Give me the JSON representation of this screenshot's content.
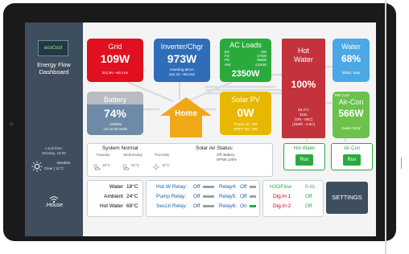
{
  "sidebar": {
    "logo": "ecoCool",
    "title_line1": "Energy Flow",
    "title_line2": "Dashboard",
    "local_time_label": "Local time:",
    "local_time_value": "Monday, 19:08",
    "weather_label": "Weather",
    "weather_value": "Clear | 11°C",
    "nav_label": ".House"
  },
  "tiles": {
    "grid": {
      "name": "Grid",
      "value": "109W",
      "detail": "241.8V ~50.1Hz",
      "color": "#e01020"
    },
    "inverter": {
      "name": "Inverter/Chgr",
      "value": "973W",
      "detail1": "Inverting 5KVA",
      "detail2": "241.3V ~50.0Hz",
      "color": "#2e6db8"
    },
    "ac_loads": {
      "name": "AC Loads",
      "value": "2350W",
      "color": "#2aaa3c",
      "rows": [
        [
          "ES",
          "0W"
        ],
        [
          "FS",
          "175W"
        ],
        [
          "PS",
          "658W"
        ],
        [
          "HW",
          "1315W"
        ]
      ]
    },
    "hot_water": {
      "name1": "Hot",
      "name2": "Water",
      "value": "100%",
      "detail1": "63.4°C",
      "detail2": "315L",
      "detail3": "[ON - 84C]",
      "detail4": "[1kWh - 4.6C]",
      "color": "#c4323c"
    },
    "water": {
      "name": "Water",
      "value": "68%",
      "detail": "3000L Tank",
      "color": "#4aa8e6"
    },
    "battery": {
      "name": "Battery",
      "value": "74%",
      "detail1": "-1005W",
      "detail2": "-15.3A  52.5Vdc",
      "color_top": "#b8bcc0",
      "color_bottom": "#6e8aa6"
    },
    "home": {
      "name": "Home",
      "color": "#f0a818"
    },
    "solar": {
      "name": "Solar PV",
      "value": "0W",
      "detail1": "Phase AC: 0W",
      "detail2": "MPPT DC: 0W",
      "color": "#e8b800"
    },
    "aircon": {
      "name": "Air-Con",
      "value": "566W",
      "detail": "Daikin 5KW",
      "tag": "MR Cool",
      "color": "#6cc24a"
    }
  },
  "system": {
    "status_label": "System Normal",
    "solar_air_label": "Solar Air Status:",
    "solar_air_detail1": "Off, Battery",
    "solar_air_detail2": "DPM6 100%",
    "days": [
      "Tuesday",
      "Wednesday",
      "Thursday"
    ],
    "temps": [
      "18°C",
      "21°C",
      "11°C"
    ]
  },
  "buttons": {
    "hot_water_label": "Hot Water",
    "hot_water_run": "Run",
    "aircon_label": "Air-Con",
    "aircon_run": "Run",
    "settings": "SETTINGS"
  },
  "temps_box": {
    "rows": [
      [
        "Water",
        "18°C"
      ],
      [
        "Ambient",
        "24°C"
      ],
      [
        "Hot Water",
        "68°C"
      ]
    ]
  },
  "relays": {
    "col1": [
      [
        "Hot W Relay:",
        "Off"
      ],
      [
        "Pump Relay:",
        "Off"
      ],
      [
        "SecLit Relay:",
        "Off"
      ]
    ],
    "col2": [
      [
        "Relay4:",
        "Off"
      ],
      [
        "Relay5:",
        "Off"
      ],
      [
        "Relay6:",
        "On"
      ]
    ]
  },
  "flow": {
    "rows": [
      [
        "H2OFlow",
        "0 l/s"
      ],
      [
        "Dig.In 1",
        "Off"
      ],
      [
        "Dig.In 2",
        "Off"
      ]
    ]
  },
  "colors": {
    "accent_green": "#2aaa3c",
    "link_blue": "#1a5fa8",
    "alert_red": "#c8001a",
    "settings_bg": "#3e4e5e"
  }
}
